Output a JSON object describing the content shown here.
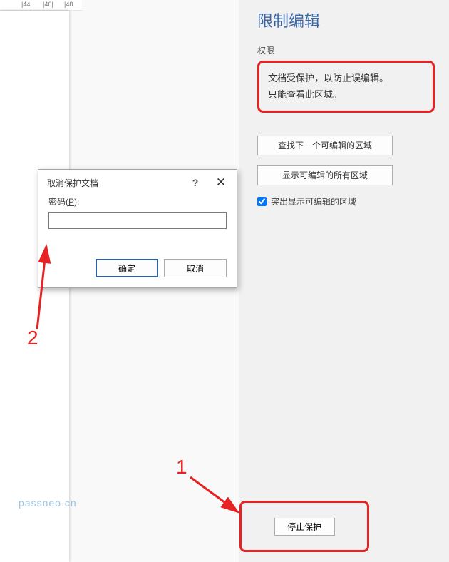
{
  "ruler": {
    "t44": "|44|",
    "t46": "|46|",
    "t48": "|48"
  },
  "panel": {
    "title": "限制编辑",
    "section_label": "权限",
    "info_line1": "文档受保护，以防止误编辑。",
    "info_line2": "只能查看此区域。",
    "btn_find_next": "查找下一个可编辑的区域",
    "btn_show_all": "显示可编辑的所有区域",
    "checkbox_label": "突出显示可编辑的区域",
    "stop_button": "停止保护"
  },
  "dialog": {
    "title": "取消保护文档",
    "help_symbol": "?",
    "close_symbol": "✕",
    "password_label_prefix": "密码(",
    "password_label_key": "P",
    "password_label_suffix": "):",
    "ok": "确定",
    "cancel": "取消"
  },
  "annotations": {
    "num1": "1",
    "num2": "2",
    "watermark": "passneo.cn"
  }
}
